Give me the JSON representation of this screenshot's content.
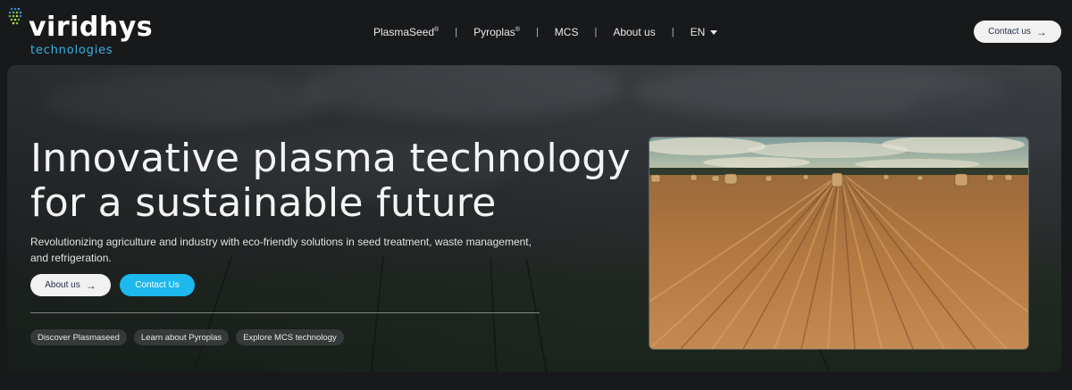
{
  "brand": {
    "name": "viridhys",
    "sub": "technologies",
    "accent": "#33b5e5"
  },
  "nav": {
    "items": [
      {
        "label": "PlasmaSeed",
        "sup": "®"
      },
      {
        "label": "Pyroplas",
        "sup": "®"
      },
      {
        "label": "MCS",
        "sup": ""
      },
      {
        "label": "About us",
        "sup": ""
      }
    ],
    "separator": "|",
    "language": "EN",
    "contact_label": "Contact us"
  },
  "hero": {
    "headline_line1": "Innovative plasma technology",
    "headline_line2": "for a sustainable future",
    "subtext": "Revolutionizing agriculture and industry with eco-friendly solutions in seed treatment, waste management, and refrigeration.",
    "about_button": "About us",
    "contact_button": "Contact Us",
    "contact_color": "#1cb8ee",
    "chips": [
      "Discover Plasmaseed",
      "Learn about Pyroplas",
      "Explore MCS technology"
    ]
  },
  "icons": {
    "arrow": "arrow-right-icon",
    "caret": "chevron-down-icon"
  }
}
